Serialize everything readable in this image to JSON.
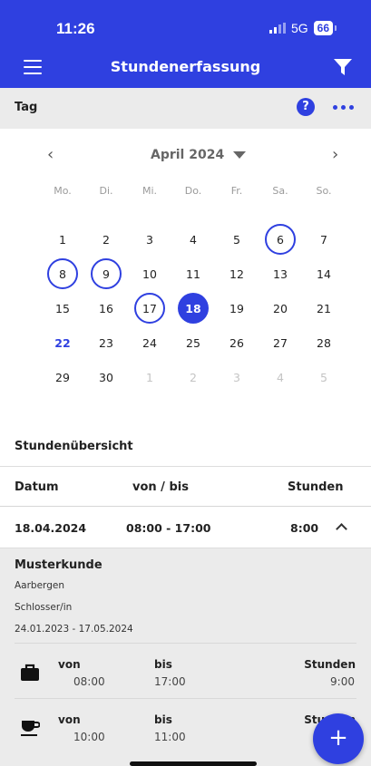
{
  "status_bar": {
    "time": "11:26",
    "network": "5G",
    "battery": "66"
  },
  "app_bar": {
    "title": "Stundenerfassung",
    "menu_icon": "hamburger-menu-icon",
    "filter_icon": "filter-funnel-icon"
  },
  "view_header": {
    "label": "Tag",
    "help_icon": "question-mark-icon",
    "more_icon": "more-dots-icon"
  },
  "calendar": {
    "month_label": "April 2024",
    "weekdays": [
      "Mo.",
      "Di.",
      "Mi.",
      "Do.",
      "Fr.",
      "Sa.",
      "So."
    ],
    "days": [
      {
        "label": "1",
        "state": "normal"
      },
      {
        "label": "2",
        "state": "normal"
      },
      {
        "label": "3",
        "state": "normal"
      },
      {
        "label": "4",
        "state": "normal"
      },
      {
        "label": "5",
        "state": "normal"
      },
      {
        "label": "6",
        "state": "outline"
      },
      {
        "label": "7",
        "state": "normal"
      },
      {
        "label": "8",
        "state": "outline"
      },
      {
        "label": "9",
        "state": "outline"
      },
      {
        "label": "10",
        "state": "normal"
      },
      {
        "label": "11",
        "state": "normal"
      },
      {
        "label": "12",
        "state": "normal"
      },
      {
        "label": "13",
        "state": "normal"
      },
      {
        "label": "14",
        "state": "normal"
      },
      {
        "label": "15",
        "state": "normal"
      },
      {
        "label": "16",
        "state": "normal"
      },
      {
        "label": "17",
        "state": "outline"
      },
      {
        "label": "18",
        "state": "selected"
      },
      {
        "label": "19",
        "state": "normal"
      },
      {
        "label": "20",
        "state": "normal"
      },
      {
        "label": "21",
        "state": "normal"
      },
      {
        "label": "22",
        "state": "today"
      },
      {
        "label": "23",
        "state": "normal"
      },
      {
        "label": "24",
        "state": "normal"
      },
      {
        "label": "25",
        "state": "normal"
      },
      {
        "label": "26",
        "state": "normal"
      },
      {
        "label": "27",
        "state": "normal"
      },
      {
        "label": "28",
        "state": "normal"
      },
      {
        "label": "29",
        "state": "normal"
      },
      {
        "label": "30",
        "state": "normal"
      },
      {
        "label": "1",
        "state": "other"
      },
      {
        "label": "2",
        "state": "other"
      },
      {
        "label": "3",
        "state": "other"
      },
      {
        "label": "4",
        "state": "other"
      },
      {
        "label": "5",
        "state": "other"
      }
    ]
  },
  "overview": {
    "title": "Stundenübersicht",
    "columns": {
      "date": "Datum",
      "range": "von / bis",
      "hours": "Stunden"
    },
    "entry": {
      "date": "18.04.2024",
      "range": "08:00 - 17:00",
      "hours": "8:00"
    },
    "details": {
      "customer": "Musterkunde",
      "location": "Aarbergen",
      "role": "Schlosser/in",
      "period": "24.01.2023 - 17.05.2024",
      "rows": [
        {
          "icon": "briefcase-icon",
          "von_label": "von",
          "von": "08:00",
          "bis_label": "bis",
          "bis": "17:00",
          "hours_label": "Stunden",
          "hours": "9:00"
        },
        {
          "icon": "coffee-cup-icon",
          "von_label": "von",
          "von": "10:00",
          "bis_label": "bis",
          "bis": "11:00",
          "hours_label": "Stunden",
          "hours": ""
        }
      ]
    }
  },
  "fab": {
    "label": "+"
  },
  "colors": {
    "primary": "#2f40e0",
    "header_bg": "#ebebeb"
  }
}
